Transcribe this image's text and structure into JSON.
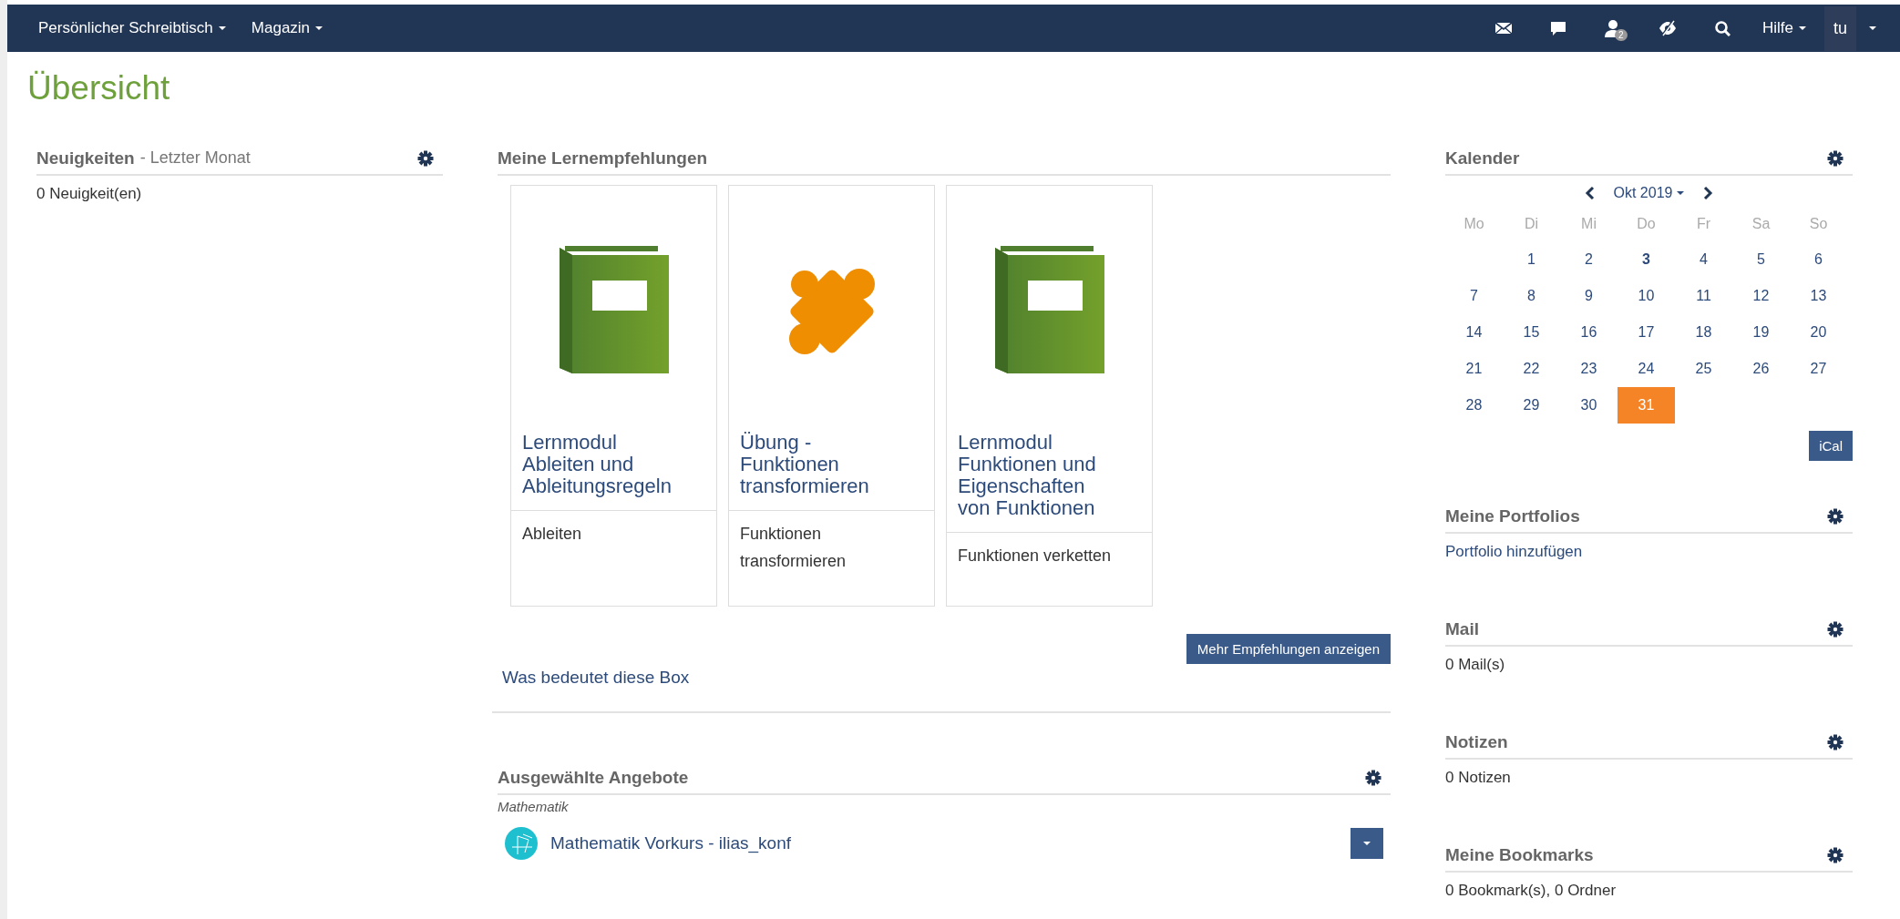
{
  "topbar": {
    "menus": [
      {
        "label": "Persönlicher Schreibtisch"
      },
      {
        "label": "Magazin"
      }
    ],
    "icons": [
      {
        "kind": "mail"
      },
      {
        "kind": "chat"
      },
      {
        "kind": "user",
        "badge": "2"
      },
      {
        "kind": "eye"
      },
      {
        "kind": "search"
      }
    ],
    "help": "Hilfe",
    "user": "tu"
  },
  "page_title": "Übersicht",
  "news": {
    "title": "Neuigkeiten",
    "subtitle": "- Letzter Monat",
    "text": "0 Neuigkeit(en)"
  },
  "recommendations": {
    "title": "Meine Lernempfehlungen",
    "cards": [
      {
        "kind": "book",
        "title": "Lernmodul Ableiten und Ableitungsregeln",
        "subtitle": "Ableiten"
      },
      {
        "kind": "puzzle",
        "title": "Übung - Funktionen transformieren",
        "subtitle": "Funktionen transformieren"
      },
      {
        "kind": "book",
        "title": "Lernmodul Funktionen und Eigenschaften von Funktionen",
        "subtitle": "Funktionen verketten"
      }
    ],
    "button": "Mehr Empfehlungen anzeigen",
    "help_link": "Was bedeutet diese Box"
  },
  "offers": {
    "title": "Ausgewählte Angebote",
    "category": "Mathematik",
    "items": [
      {
        "title": "Mathematik Vorkurs - ilias_konf"
      }
    ]
  },
  "calendar": {
    "title": "Kalender",
    "month": "Okt 2019",
    "weekdays": [
      "Mo",
      "Di",
      "Mi",
      "Do",
      "Fr",
      "Sa",
      "So"
    ],
    "weeks": [
      [
        {
          "kind": "empty"
        },
        {
          "label": "1",
          "bold": false,
          "selected": false
        },
        {
          "label": "2",
          "bold": false,
          "selected": false
        },
        {
          "label": "3",
          "bold": true,
          "selected": false
        },
        {
          "label": "4",
          "bold": false,
          "selected": false
        },
        {
          "label": "5",
          "bold": false,
          "selected": false
        },
        {
          "label": "6",
          "bold": false,
          "selected": false
        }
      ],
      [
        {
          "label": "7",
          "bold": false,
          "selected": false
        },
        {
          "label": "8",
          "bold": false,
          "selected": false
        },
        {
          "label": "9",
          "bold": false,
          "selected": false
        },
        {
          "label": "10",
          "bold": false,
          "selected": false
        },
        {
          "label": "11",
          "bold": false,
          "selected": false
        },
        {
          "label": "12",
          "bold": false,
          "selected": false
        },
        {
          "label": "13",
          "bold": false,
          "selected": false
        }
      ],
      [
        {
          "label": "14",
          "bold": false,
          "selected": false
        },
        {
          "label": "15",
          "bold": false,
          "selected": false
        },
        {
          "label": "16",
          "bold": false,
          "selected": false
        },
        {
          "label": "17",
          "bold": false,
          "selected": false
        },
        {
          "label": "18",
          "bold": false,
          "selected": false
        },
        {
          "label": "19",
          "bold": false,
          "selected": false
        },
        {
          "label": "20",
          "bold": false,
          "selected": false
        }
      ],
      [
        {
          "label": "21",
          "bold": false,
          "selected": false
        },
        {
          "label": "22",
          "bold": false,
          "selected": false
        },
        {
          "label": "23",
          "bold": false,
          "selected": false
        },
        {
          "label": "24",
          "bold": false,
          "selected": false
        },
        {
          "label": "25",
          "bold": false,
          "selected": false
        },
        {
          "label": "26",
          "bold": false,
          "selected": false
        },
        {
          "label": "27",
          "bold": false,
          "selected": false
        }
      ],
      [
        {
          "label": "28",
          "bold": false,
          "selected": false
        },
        {
          "label": "29",
          "bold": false,
          "selected": false
        },
        {
          "label": "30",
          "bold": false,
          "selected": false
        },
        {
          "label": "31",
          "bold": false,
          "selected": true
        },
        {
          "kind": "empty"
        },
        {
          "kind": "empty"
        },
        {
          "kind": "empty"
        }
      ]
    ],
    "button": "iCal"
  },
  "side_blocks": [
    {
      "title": "Meine Portfolios",
      "text": "Portfolio hinzufügen",
      "link": true
    },
    {
      "title": "Mail",
      "text": "0 Mail(s)",
      "link": false
    },
    {
      "title": "Notizen",
      "text": "0 Notizen",
      "link": false
    },
    {
      "title": "Meine Bookmarks",
      "text": "0 Bookmark(s), 0 Ordner",
      "link": false
    }
  ]
}
